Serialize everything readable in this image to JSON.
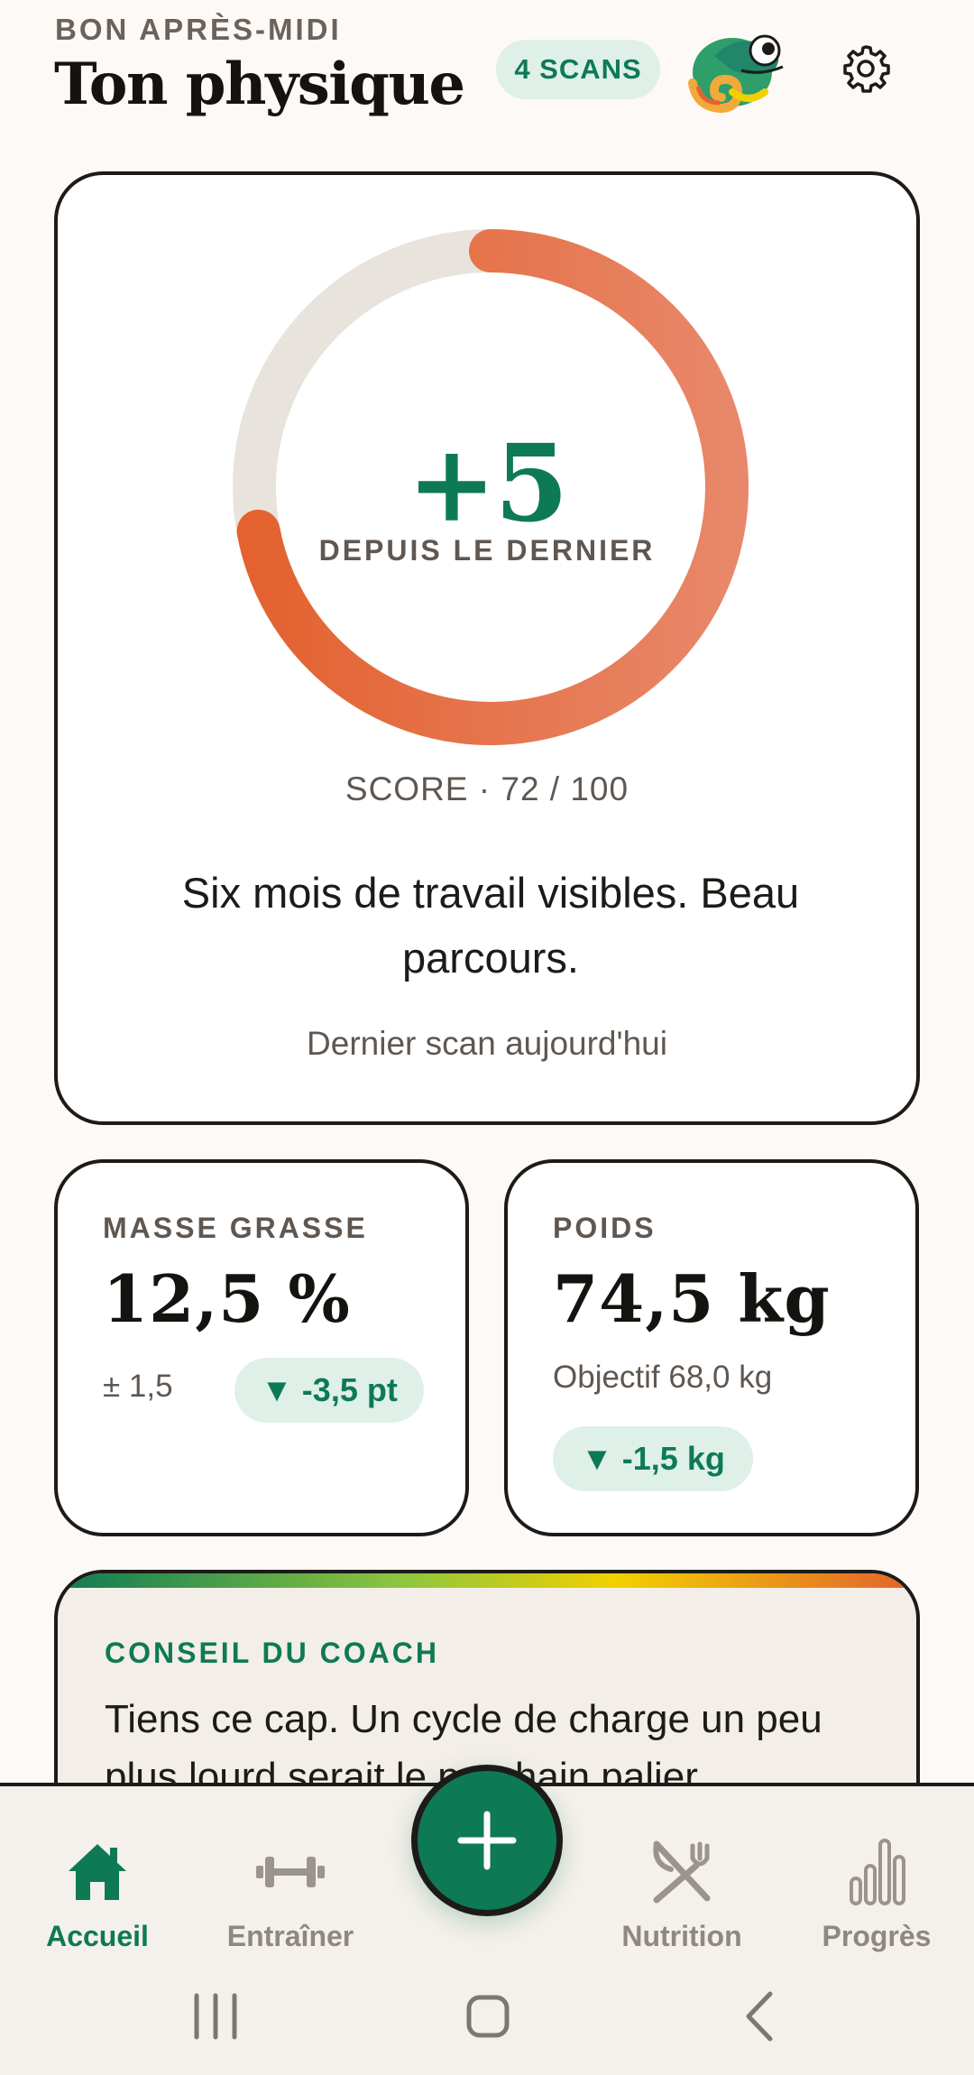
{
  "header": {
    "greeting": "BON APRÈS-MIDI",
    "title": "Ton physique",
    "scans_badge": "4 SCANS",
    "mascot_icon": "chameleon-icon",
    "settings_icon": "gear-icon"
  },
  "score_card": {
    "delta": "+5",
    "since_label": "DEPUIS LE DERNIER",
    "score_text": "SCORE · 72 / 100",
    "score": 72,
    "score_max": 100,
    "message": "Six mois de travail visibles. Beau parcours.",
    "last_scan": "Dernier scan aujourd'hui",
    "colors": {
      "ring_progress": "#e3622f",
      "ring_track": "#e8e3dc",
      "accent": "#0e7a55"
    }
  },
  "metrics": {
    "body_fat": {
      "label": "MASSE GRASSE",
      "value": "12,5 %",
      "uncertainty": "± 1,5",
      "delta": "▼ -3,5 pt"
    },
    "weight": {
      "label": "POIDS",
      "value": "74,5 kg",
      "goal": "Objectif 68,0 kg",
      "delta": "▼ -1,5 kg"
    }
  },
  "coach": {
    "label": "CONSEIL DU COACH",
    "text": "Tiens ce cap. Un cycle de charge un peu plus lourd serait le prochain palier."
  },
  "nav": {
    "items": [
      {
        "label": "Accueil",
        "icon": "home-icon",
        "active": true
      },
      {
        "label": "Entraîner",
        "icon": "dumbbell-icon",
        "active": false
      },
      {
        "label": "Nutrition",
        "icon": "fork-knife-icon",
        "active": false
      },
      {
        "label": "Progrès",
        "icon": "bar-chart-icon",
        "active": false
      }
    ],
    "fab_icon": "plus-icon"
  },
  "system_nav": {
    "icons": [
      "recent-apps-icon",
      "home-button-icon",
      "back-icon"
    ]
  }
}
